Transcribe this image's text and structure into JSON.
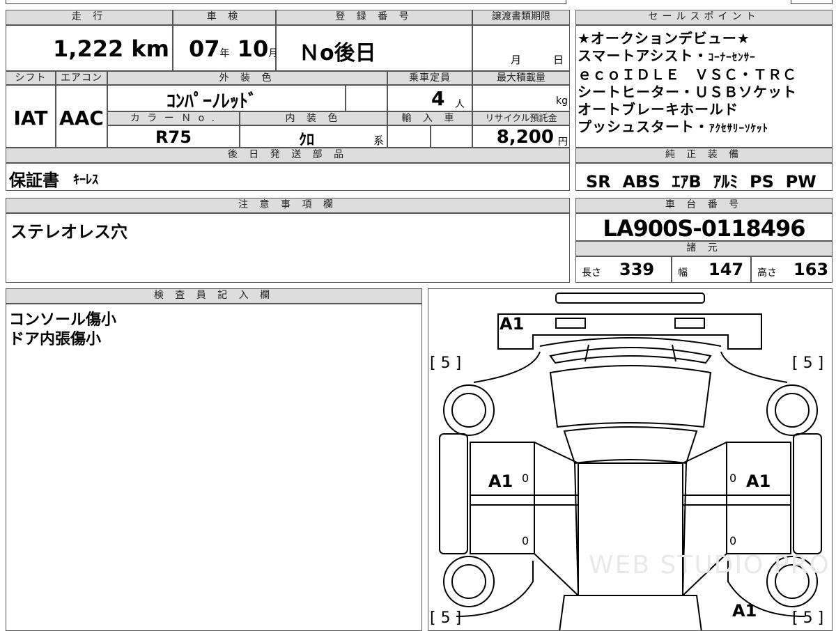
{
  "specs": {
    "mileage_header": "走 行",
    "mileage_value": "1,222",
    "mileage_unit": "km",
    "inspection_header": "車 検",
    "inspection_year": "07",
    "inspection_year_unit": "年",
    "inspection_month": "10",
    "inspection_month_unit": "月",
    "registration_header": "登 録 番 号",
    "registration_value": "Ｎo後日",
    "transfer_header": "譲渡書類期限",
    "transfer_month_unit": "月",
    "transfer_day_unit": "日",
    "shift_header": "シフト",
    "shift_value": "IAT",
    "ac_header": "エアコン",
    "ac_value": "AAC",
    "exterior_header": "外 装 色",
    "exterior_value": "ｺﾝﾊﾟｰﾉﾚｯﾄﾞ",
    "color_no_header": "カ ラ ー Ｎ o .",
    "color_no_value": "R75",
    "interior_header": "内 装 色",
    "interior_value": "ｸﾛ",
    "interior_suffix": "系",
    "capacity_header": "乗車定員",
    "capacity_value": "4",
    "capacity_unit": "人",
    "load_header": "最大積載量",
    "load_unit": "kg",
    "import_header": "輸 入 車",
    "recycle_header": "リサイクル預託金",
    "recycle_value": "8,200",
    "recycle_unit": "円",
    "later_parts_header": "後 日 発 送 部 品",
    "later_parts_main": "保証書",
    "later_parts_extra": "ｷｰﾚｽ"
  },
  "selling_points": {
    "header": "セールスポイント",
    "lines": [
      {
        "main": "★オークションデビュー★",
        "small": ""
      },
      {
        "main": "スマートアシスト・",
        "small": "ｺｰﾅｰｾﾝｻｰ"
      },
      {
        "main": "ｅｃｏＩＤＬＥ　ＶＳＣ・ＴＲＣ",
        "small": ""
      },
      {
        "main": "シートヒーター・ＵＳＢソケット",
        "small": ""
      },
      {
        "main": "オートブレーキホールド",
        "small": ""
      },
      {
        "main": "プッシュスタート・",
        "small": "ｱｸｾｻﾘｰｿｹｯﾄ"
      }
    ]
  },
  "genuine_equipment": {
    "header": "純 正 装 備",
    "value": "SR  ABS  ｴｱB  ｱﾙﾐ  PS  PW"
  },
  "notes": {
    "header": "注 意 事 項 欄",
    "value": "ステレオレス穴"
  },
  "chassis": {
    "header": "車 台 番 号",
    "value": "LA900S-0118496",
    "dims_header": "諸 元",
    "length_label": "長さ",
    "length_value": "339",
    "width_label": "幅",
    "width_value": "147",
    "height_label": "高さ",
    "height_value": "163"
  },
  "inspector": {
    "header": "検 査 員 記 入 欄",
    "lines": [
      "コンソール傷小",
      "ドア内張傷小"
    ]
  },
  "diagram": {
    "marks": {
      "top_left": "A1",
      "left_door": "A1",
      "right_door": "A1",
      "bottom_right": "A1",
      "tire_tl": "[ 5 ]",
      "tire_tr": "[ 5 ]",
      "tire_bl": "[ 5 ]",
      "tire_br": "[ 5 ]",
      "zero_1": "0",
      "zero_2": "0",
      "zero_3": "0",
      "zero_4": "0"
    },
    "watermark": "WEB STUDIO PRO"
  }
}
